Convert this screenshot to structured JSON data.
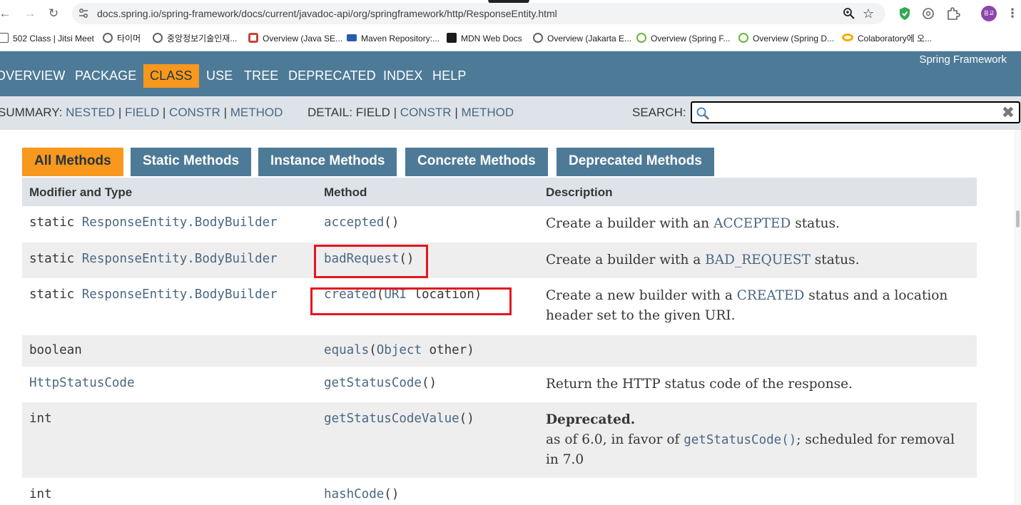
{
  "browser": {
    "url": "docs.spring.io/spring-framework/docs/current/javadoc-api/org/springframework/http/ResponseEntity.html",
    "profile_initials": "용교",
    "bookmarks": [
      {
        "label": "502 Class | Jitsi Meet",
        "icon": "jitsi-icon",
        "color": "#ffffff"
      },
      {
        "label": "타이머",
        "icon": "globe-icon",
        "color": "#5f6368"
      },
      {
        "label": "중앙정보기술인재...",
        "icon": "globe-icon",
        "color": "#5f6368"
      },
      {
        "label": "Overview (Java SE...",
        "icon": "oracle-icon",
        "color": "#c74634"
      },
      {
        "label": "Maven Repository:...",
        "icon": "maven-icon",
        "color": "#2a5ba8"
      },
      {
        "label": "MDN Web Docs",
        "icon": "mdn-icon",
        "color": "#1b1b1b"
      },
      {
        "label": "Overview (Jakarta E...",
        "icon": "globe-icon",
        "color": "#5f6368"
      },
      {
        "label": "Overview (Spring F...",
        "icon": "spring-icon",
        "color": "#6db33f"
      },
      {
        "label": "Overview (Spring D...",
        "icon": "spring-icon",
        "color": "#6db33f"
      },
      {
        "label": "Colaboratory에 오...",
        "icon": "colab-icon",
        "color": "#f9ab00"
      }
    ]
  },
  "topnav": {
    "items": [
      "OVERVIEW",
      "PACKAGE",
      "CLASS",
      "USE",
      "TREE",
      "DEPRECATED",
      "INDEX",
      "HELP"
    ],
    "active": "CLASS",
    "brand": "Spring Framework"
  },
  "subnav": {
    "summary_label": "SUMMARY:",
    "summary_links": [
      "NESTED",
      "FIELD",
      "CONSTR",
      "METHOD"
    ],
    "detail_label": "DETAIL:",
    "detail_plain": "FIELD",
    "detail_links": [
      "CONSTR",
      "METHOD"
    ],
    "separator": "|",
    "search_label": "SEARCH:",
    "search_value": ""
  },
  "method_tabs": [
    "All Methods",
    "Static Methods",
    "Instance Methods",
    "Concrete Methods",
    "Deprecated Methods"
  ],
  "table": {
    "headers": [
      "Modifier and Type",
      "Method",
      "Description"
    ],
    "rows": [
      {
        "mod": "static",
        "type": "ResponseEntity.BodyBuilder",
        "method": "accepted",
        "params": "()",
        "desc_pre": "Create a builder with an ",
        "desc_link": "ACCEPTED",
        "desc_post": " status."
      },
      {
        "mod": "static",
        "type": "ResponseEntity.BodyBuilder",
        "method": "badRequest",
        "params": "()",
        "desc_pre": "Create a builder with a ",
        "desc_link": "BAD_REQUEST",
        "desc_post": " status."
      },
      {
        "mod": "static",
        "type": "ResponseEntity.BodyBuilder",
        "method": "created",
        "params": "(URI location)",
        "params_open": "(",
        "params_type": "URI",
        "params_name": " location)",
        "desc_pre": "Create a new builder with a ",
        "desc_link": "CREATED",
        "desc_post": " status and a location header set to the given URI."
      },
      {
        "mod": "",
        "type": "boolean",
        "method": "equals",
        "params_open": "(",
        "params_type": "Object",
        "params_name": " other)",
        "desc_pre": "",
        "desc_link": "",
        "desc_post": ""
      },
      {
        "mod": "",
        "type": "HttpStatusCode",
        "method": "getStatusCode",
        "params": "()",
        "desc_pre": "Return the HTTP status code of the response.",
        "desc_link": "",
        "desc_post": ""
      },
      {
        "mod": "",
        "type": "int",
        "method": "getStatusCodeValue",
        "params": "()",
        "desc_bold": "Deprecated.",
        "desc_pre": "as of 6.0, in favor of ",
        "desc_link": "getStatusCode()",
        "desc_post": "; scheduled for removal in 7.0"
      },
      {
        "mod": "",
        "type": "int",
        "method": "hashCode",
        "params": "()",
        "desc_pre": "",
        "desc_link": "",
        "desc_post": ""
      }
    ]
  },
  "colors": {
    "nav_blue": "#4d7a97",
    "nav_orange": "#f8981d",
    "subnav_gray": "#dee3e9",
    "link": "#4a6782",
    "highlight_box": "#e5161f"
  }
}
